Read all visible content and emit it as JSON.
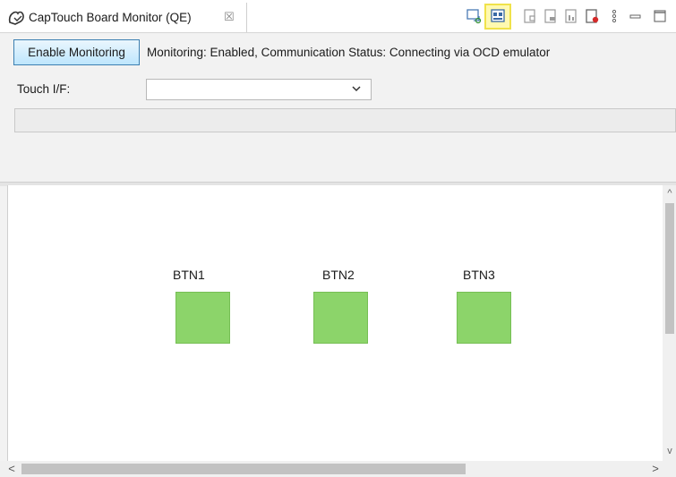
{
  "tab": {
    "title": "CapTouch Board Monitor (QE)",
    "close_glyph": "☒",
    "icon": "captouch-hand-icon"
  },
  "toolbar": {
    "icons": [
      "monitor-refresh-icon",
      "show-board-icon",
      "view-icon-1",
      "view-icon-2",
      "view-icon-3",
      "view-icon-record",
      "view-menu-icon",
      "minimize-icon",
      "maximize-icon"
    ],
    "highlight_color": "#f0e24a"
  },
  "panel": {
    "enable_button_label": "Enable Monitoring",
    "status_text": "Monitoring: Enabled, Communication Status: Connecting via OCD emulator",
    "touch_if_label": "Touch I/F:",
    "touch_if_value": ""
  },
  "canvas": {
    "buttons": [
      {
        "label": "BTN1",
        "color": "#8cd46a"
      },
      {
        "label": "BTN2",
        "color": "#8cd46a"
      },
      {
        "label": "BTN3",
        "color": "#8cd46a"
      }
    ]
  },
  "scroll": {
    "left_arrow": "<",
    "right_arrow": ">",
    "up_arrow": "^",
    "down_arrow": "v"
  }
}
